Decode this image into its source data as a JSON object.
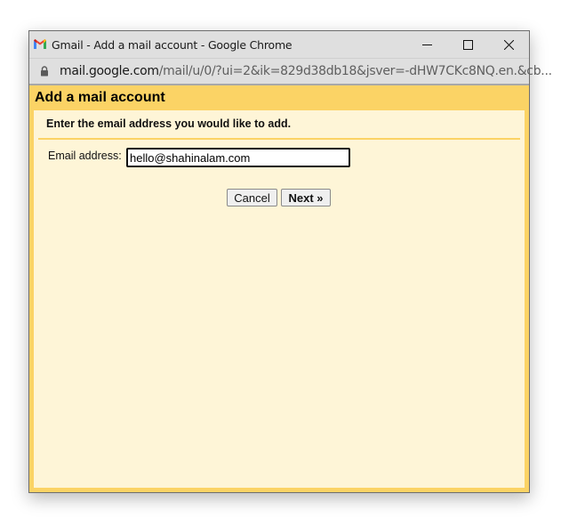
{
  "window": {
    "title": "Gmail - Add a mail account - Google Chrome",
    "icon": "gmail-icon",
    "controls": {
      "minimize": "minimize-icon",
      "maximize": "maximize-icon",
      "close": "close-icon"
    }
  },
  "address_bar": {
    "icon": "lock-icon",
    "host": "mail.google.com",
    "path": "/mail/u/0/?ui=2&ik=829d38db18&jsver=-dHW7CKc8NQ.en.&cb..."
  },
  "dialog": {
    "title": "Add a mail account",
    "instruction": "Enter the email address you would like to add.",
    "email_label": "Email address:",
    "email_value": "hello@shahinalam.com",
    "cancel_label": "Cancel",
    "next_label": "Next »"
  },
  "colors": {
    "header_yellow": "#fbd365",
    "body_cream": "#fef5d7",
    "chrome_gray": "#dfdfdf"
  }
}
